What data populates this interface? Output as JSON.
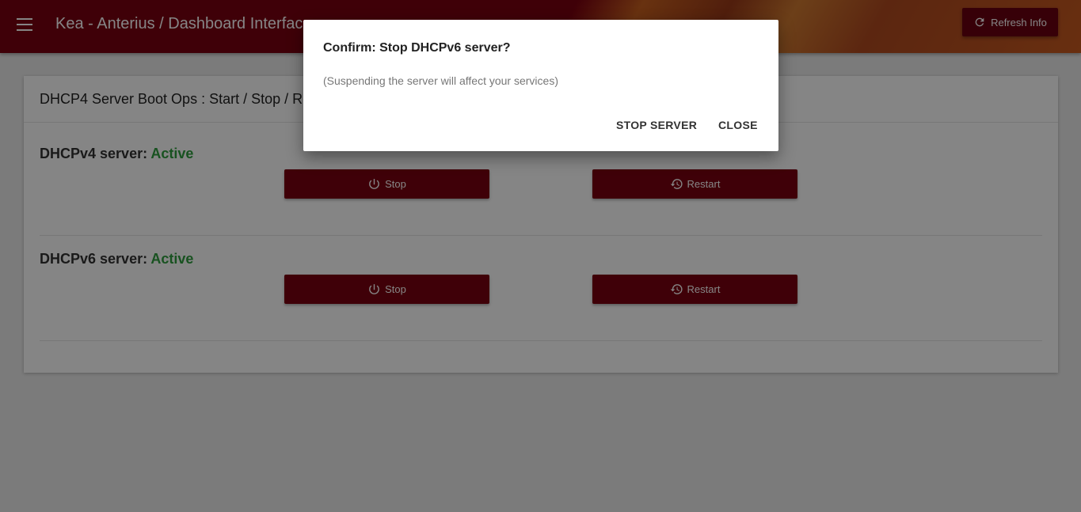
{
  "toolbar": {
    "title": "Kea - Anterius / Dashboard Interface",
    "refresh_label": "Refresh Info"
  },
  "card": {
    "header": "DHCP4 Server Boot Ops : Start / Stop / Restart",
    "servers": [
      {
        "label": "DHCPv4 server: ",
        "status": "Active",
        "stop_label": "Stop",
        "restart_label": "Restart"
      },
      {
        "label": "DHCPv6 server: ",
        "status": "Active",
        "stop_label": "Stop",
        "restart_label": "Restart"
      }
    ]
  },
  "dialog": {
    "title": "Confirm: Stop DHCPv6 server?",
    "body": "(Suspending the server will affect your services)",
    "confirm_label": "STOP SERVER",
    "close_label": "CLOSE"
  },
  "colors": {
    "primary": "#7a0010",
    "status_active": "#2e9e3e"
  }
}
